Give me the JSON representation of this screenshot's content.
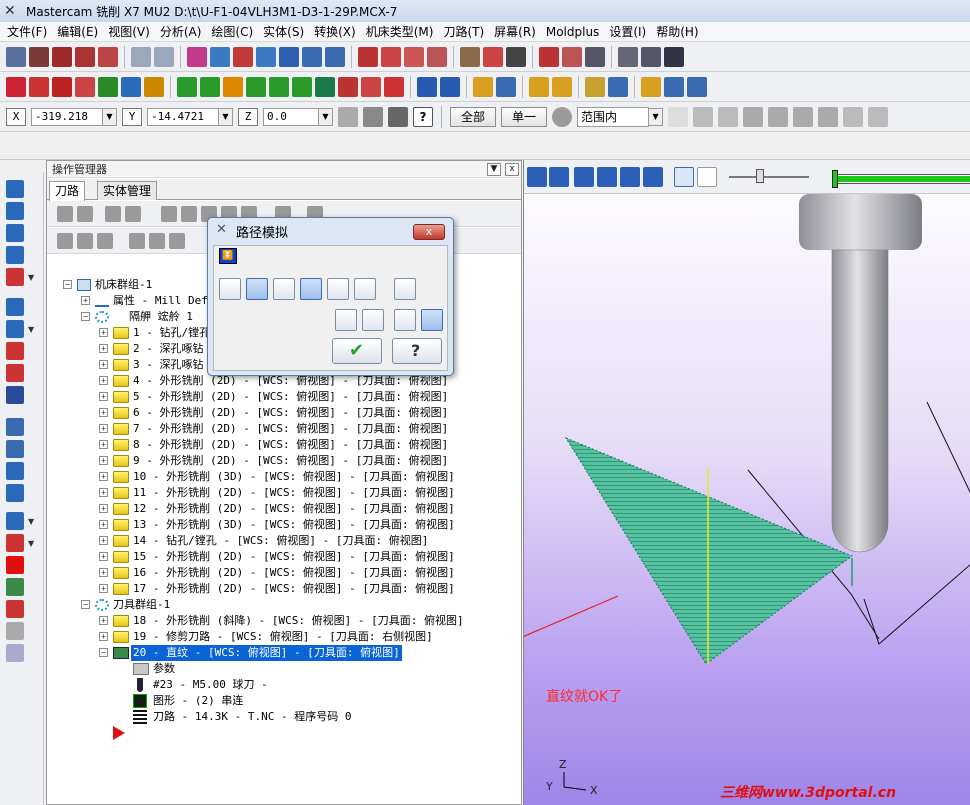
{
  "window": {
    "title": "Mastercam 铣削 X7 MU2  D:\\t\\U-F1-04VLH3M1-D3-1-29P.MCX-7"
  },
  "menu": [
    "文件(F)",
    "编辑(E)",
    "视图(V)",
    "分析(A)",
    "绘图(C)",
    "实体(S)",
    "转换(X)",
    "机床类型(M)",
    "刀路(T)",
    "屏幕(R)",
    "Moldplus",
    "设置(I)",
    "帮助(H)"
  ],
  "coords": {
    "x_label": "X",
    "x_value": "-319.218",
    "y_label": "Y",
    "y_value": "-14.4721",
    "z_label": "Z",
    "z_value": "0.0",
    "btn_all": "全部",
    "btn_single": "单一",
    "range_select": "范围内"
  },
  "ops_manager": {
    "title": "操作管理器",
    "close_label": "x",
    "tabs": [
      "刀路",
      "实体管理"
    ]
  },
  "tree": {
    "machine_group": "机床群组-1",
    "properties": "属性 - Mill Def",
    "stock": "隔舺 竤舲 1",
    "ops": [
      "1 - 钻孔/镗孔",
      "2 - 深孔啄钻",
      "3 - 深孔啄钻",
      "4 - 外形铣削 (2D) - [WCS: 俯视图] - [刀具面: 俯视图]",
      "5 - 外形铣削 (2D) - [WCS: 俯视图] - [刀具面: 俯视图]",
      "6 - 外形铣削 (2D) - [WCS: 俯视图] - [刀具面: 俯视图]",
      "7 - 外形铣削 (2D) - [WCS: 俯视图] - [刀具面: 俯视图]",
      "8 - 外形铣削 (2D) - [WCS: 俯视图] - [刀具面: 俯视图]",
      "9 - 外形铣削 (2D) - [WCS: 俯视图] - [刀具面: 俯视图]",
      "10 - 外形铣削 (3D) - [WCS: 俯视图] - [刀具面: 俯视图]",
      "11 - 外形铣削 (2D) - [WCS: 俯视图] - [刀具面: 俯视图]",
      "12 - 外形铣削 (2D) - [WCS: 俯视图] - [刀具面: 俯视图]",
      "13 - 外形铣削 (3D) - [WCS: 俯视图] - [刀具面: 俯视图]",
      "14 - 钻孔/镗孔 - [WCS: 俯视图] - [刀具面: 俯视图]",
      "15 - 外形铣削 (2D) - [WCS: 俯视图] - [刀具面: 俯视图]",
      "16 - 外形铣削 (2D) - [WCS: 俯视图] - [刀具面: 俯视图]",
      "17 - 外形铣削 (2D) - [WCS: 俯视图] - [刀具面: 俯视图]"
    ],
    "tool_group": "刀具群组-1",
    "ops2": [
      "18 - 外形铣削 (斜降) - [WCS: 俯视图] - [刀具面: 俯视图]",
      "19 - 修剪刀路 - [WCS: 俯视图] - [刀具面: 右侧视图]"
    ],
    "selected_op": "20 - 直纹 - [WCS: 俯视图] - [刀具面: 俯视图]",
    "sub": {
      "params": "参数",
      "tool": "#23 - M5.00 球刀 -",
      "geometry": "图形 - (2) 串连",
      "toolpath": "刀路 - 14.3K - T.NC - 程序号码 0"
    }
  },
  "dialog": {
    "title": "路径模拟",
    "close_label": "x"
  },
  "viewport": {
    "annotation": "直纹就OK了",
    "axis_y": "Y",
    "axis_z": "Z",
    "axis_x": "X",
    "watermark": "三维网www.3dportal.cn"
  }
}
